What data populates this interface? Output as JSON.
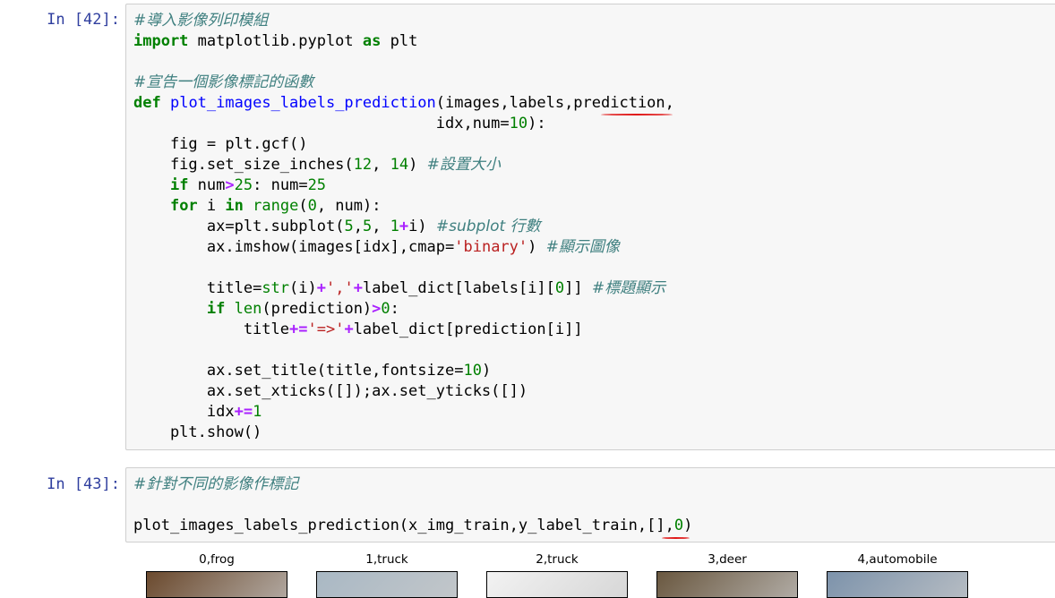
{
  "cells": [
    {
      "prompt": "In [42]:",
      "lines": [
        [
          {
            "t": "#導入影像列印模組",
            "c": "comment"
          }
        ],
        [
          {
            "t": "import",
            "c": "keyword"
          },
          {
            "t": " matplotlib.pyplot ",
            "c": ""
          },
          {
            "t": "as",
            "c": "keyword"
          },
          {
            "t": " plt",
            "c": ""
          }
        ],
        [
          {
            "t": "",
            "c": ""
          }
        ],
        [
          {
            "t": "#宣告一個影像標記的函數",
            "c": "comment"
          }
        ],
        [
          {
            "t": "def",
            "c": "keyword"
          },
          {
            "t": " ",
            "c": ""
          },
          {
            "t": "plot_images_labels_prediction",
            "c": "func"
          },
          {
            "t": "(images,labels,prediction,",
            "c": ""
          }
        ],
        [
          {
            "t": "                                 idx,num",
            "c": ""
          },
          {
            "t": "=",
            "c": ""
          },
          {
            "t": "10",
            "c": "number"
          },
          {
            "t": "):",
            "c": ""
          }
        ],
        [
          {
            "t": "    fig ",
            "c": ""
          },
          {
            "t": "=",
            "c": ""
          },
          {
            "t": " plt.gcf()",
            "c": ""
          }
        ],
        [
          {
            "t": "    fig.set_size_inches(",
            "c": ""
          },
          {
            "t": "12",
            "c": "number"
          },
          {
            "t": ", ",
            "c": ""
          },
          {
            "t": "14",
            "c": "number"
          },
          {
            "t": ") ",
            "c": ""
          },
          {
            "t": "#設置大小",
            "c": "comment"
          }
        ],
        [
          {
            "t": "    ",
            "c": ""
          },
          {
            "t": "if",
            "c": "keyword"
          },
          {
            "t": " num",
            "c": ""
          },
          {
            "t": ">",
            "c": "op"
          },
          {
            "t": "25",
            "c": "number"
          },
          {
            "t": ": num",
            "c": ""
          },
          {
            "t": "=",
            "c": ""
          },
          {
            "t": "25",
            "c": "number"
          }
        ],
        [
          {
            "t": "    ",
            "c": ""
          },
          {
            "t": "for",
            "c": "keyword"
          },
          {
            "t": " i ",
            "c": ""
          },
          {
            "t": "in",
            "c": "keyword"
          },
          {
            "t": " ",
            "c": ""
          },
          {
            "t": "range",
            "c": "builtin"
          },
          {
            "t": "(",
            "c": ""
          },
          {
            "t": "0",
            "c": "number"
          },
          {
            "t": ", num):",
            "c": ""
          }
        ],
        [
          {
            "t": "        ax",
            "c": ""
          },
          {
            "t": "=",
            "c": ""
          },
          {
            "t": "plt.subplot(",
            "c": ""
          },
          {
            "t": "5",
            "c": "number"
          },
          {
            "t": ",",
            "c": ""
          },
          {
            "t": "5",
            "c": "number"
          },
          {
            "t": ", ",
            "c": ""
          },
          {
            "t": "1",
            "c": "number"
          },
          {
            "t": "+",
            "c": "op"
          },
          {
            "t": "i) ",
            "c": ""
          },
          {
            "t": "#subplot 行數",
            "c": "comment"
          }
        ],
        [
          {
            "t": "        ax.imshow(images[idx],cmap",
            "c": ""
          },
          {
            "t": "=",
            "c": ""
          },
          {
            "t": "'binary'",
            "c": "string"
          },
          {
            "t": ") ",
            "c": ""
          },
          {
            "t": "#顯示圖像",
            "c": "comment"
          }
        ],
        [
          {
            "t": "",
            "c": ""
          }
        ],
        [
          {
            "t": "        title",
            "c": ""
          },
          {
            "t": "=",
            "c": ""
          },
          {
            "t": "str",
            "c": "builtin"
          },
          {
            "t": "(i)",
            "c": ""
          },
          {
            "t": "+",
            "c": "op"
          },
          {
            "t": "','",
            "c": "string"
          },
          {
            "t": "+",
            "c": "op"
          },
          {
            "t": "label_dict[labels[i][",
            "c": ""
          },
          {
            "t": "0",
            "c": "number"
          },
          {
            "t": "]] ",
            "c": ""
          },
          {
            "t": "#標題顯示",
            "c": "comment"
          }
        ],
        [
          {
            "t": "        ",
            "c": ""
          },
          {
            "t": "if",
            "c": "keyword"
          },
          {
            "t": " ",
            "c": ""
          },
          {
            "t": "len",
            "c": "builtin"
          },
          {
            "t": "(prediction)",
            "c": ""
          },
          {
            "t": ">",
            "c": "op"
          },
          {
            "t": "0",
            "c": "number"
          },
          {
            "t": ":",
            "c": ""
          }
        ],
        [
          {
            "t": "            title",
            "c": ""
          },
          {
            "t": "+=",
            "c": "op"
          },
          {
            "t": "'=>'",
            "c": "string"
          },
          {
            "t": "+",
            "c": "op"
          },
          {
            "t": "label_dict[prediction[i]]",
            "c": ""
          }
        ],
        [
          {
            "t": "",
            "c": ""
          }
        ],
        [
          {
            "t": "        ax.set_title(title,fontsize",
            "c": ""
          },
          {
            "t": "=",
            "c": ""
          },
          {
            "t": "10",
            "c": "number"
          },
          {
            "t": ")",
            "c": ""
          }
        ],
        [
          {
            "t": "        ax.set_xticks([]);ax.set_yticks([])",
            "c": ""
          }
        ],
        [
          {
            "t": "        idx",
            "c": ""
          },
          {
            "t": "+=",
            "c": "op"
          },
          {
            "t": "1",
            "c": "number"
          }
        ],
        [
          {
            "t": "    plt.show()",
            "c": ""
          }
        ]
      ]
    },
    {
      "prompt": "In [43]:",
      "lines": [
        [
          {
            "t": "#針對不同的影像作標記",
            "c": "comment"
          }
        ],
        [
          {
            "t": "",
            "c": ""
          }
        ],
        [
          {
            "t": "plot_images_labels_prediction(x_img_train,y_label_train,[],",
            "c": ""
          },
          {
            "t": "0",
            "c": "number"
          },
          {
            "t": ")",
            "c": ""
          }
        ]
      ]
    }
  ],
  "output": {
    "thumbnails": [
      {
        "title": "0,frog",
        "color": "#6b4a2e"
      },
      {
        "title": "1,truck",
        "color": "#a9b8c4"
      },
      {
        "title": "2,truck",
        "color": "#f2f2f2"
      },
      {
        "title": "3,deer",
        "color": "#6a5840"
      },
      {
        "title": "4,automobile",
        "color": "#7d93ab"
      }
    ]
  },
  "colors": {
    "annotation": "#e01818",
    "prompt": "#303f9f"
  }
}
